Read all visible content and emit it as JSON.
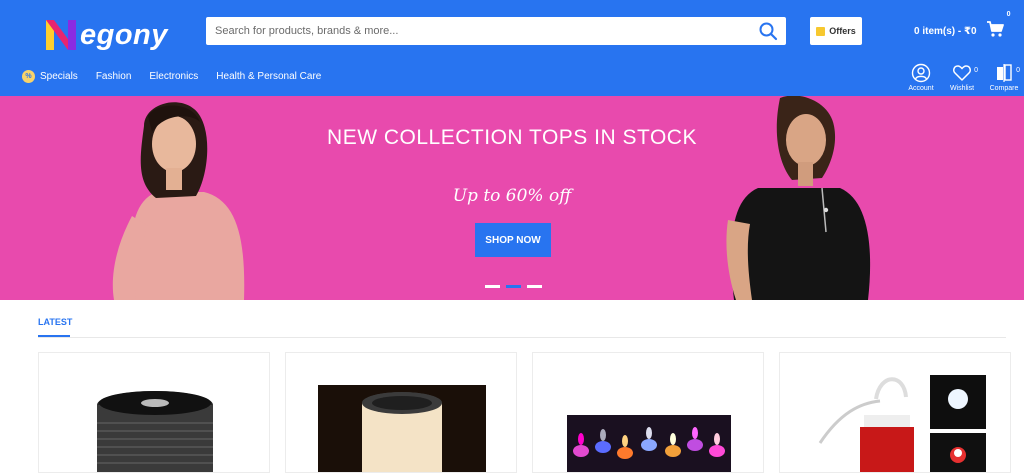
{
  "brand": {
    "name": "egony",
    "accent": "#2874f0",
    "banner_color": "#e84aad"
  },
  "search": {
    "placeholder": "Search for products, brands & more..."
  },
  "header": {
    "offers_label": "Offers",
    "cart_label": "0 item(s) - ₹0",
    "cart_count": "0"
  },
  "nav": {
    "special_badge": "%",
    "items": [
      {
        "label": "Specials"
      },
      {
        "label": "Fashion"
      },
      {
        "label": "Electronics"
      },
      {
        "label": "Health & Personal Care"
      }
    ]
  },
  "utility": {
    "account_label": "Account",
    "wishlist_label": "Wishlist",
    "wishlist_count": "0",
    "compare_label": "Compare",
    "compare_count": "0"
  },
  "banner": {
    "title": "NEW COLLECTION TOPS IN STOCK",
    "subtitle": "Up to 60% off",
    "button_label": "SHOP NOW",
    "slides": 3,
    "active_slide": 2
  },
  "latest": {
    "tab_label": "LATEST"
  },
  "icons": [
    "logo-n-icon",
    "search-icon",
    "offer-tag-icon",
    "cart-icon",
    "user-icon",
    "heart-icon",
    "compare-icon",
    "percent-icon"
  ]
}
